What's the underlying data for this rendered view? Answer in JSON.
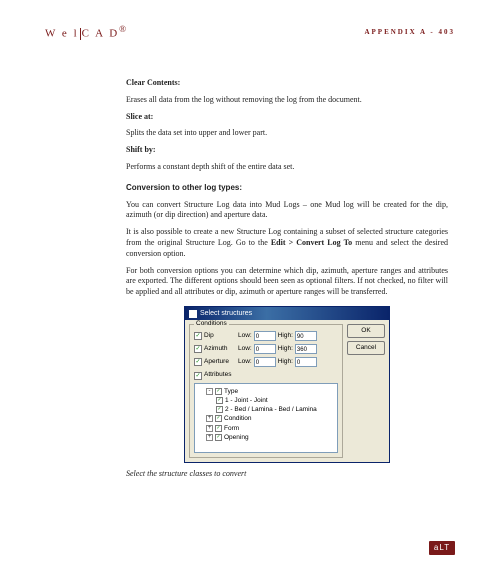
{
  "header": {
    "logo_left": "W e l",
    "logo_right": "C A D",
    "page_ref": "APPENDIX A - 403"
  },
  "body": {
    "h1": "Clear Contents:",
    "p1": "Erases all data from the log without removing the log from the document.",
    "h2": "Slice at:",
    "p2": "Splits the data set into upper and lower part.",
    "h3": "Shift by:",
    "p3": "Performs a constant depth shift of the entire data set.",
    "section": "Conversion to other log types:",
    "p4": "You can convert Structure Log data into Mud Logs – one Mud log will be created for the dip, azimuth (or dip direction) and aperture data.",
    "p5a": "It is also possible to create a new Structure Log containing a subset of selected structure categories from the original Structure Log. Go to the ",
    "p5b": "Edit > Convert Log To",
    "p5c": " menu and select the desired conversion option.",
    "p6": "For both conversion options you can determine which dip, azimuth, aperture ranges and attributes are exported. The different options should been seen as optional filters. If not checked, no filter will be applied and all attributes or dip, azimuth or aperture ranges will be transferred.",
    "caption": "Select the structure classes to convert"
  },
  "dialog": {
    "title": "Select structures",
    "conditions_label": "Conditions",
    "rows": [
      {
        "name": "Dip",
        "low": "0",
        "high": "90"
      },
      {
        "name": "Azimuth",
        "low": "0",
        "high": "360"
      },
      {
        "name": "Aperture",
        "low": "0",
        "high": "0"
      }
    ],
    "low_label": "Low:",
    "high_label": "High:",
    "attributes_label": "Attributes",
    "tree": {
      "root": "Type",
      "items": [
        "1 - Joint - Joint",
        "2 - Bed / Lamina - Bed / Lamina",
        "Condition",
        "Form",
        "Opening"
      ]
    },
    "ok": "OK",
    "cancel": "Cancel"
  },
  "footer": {
    "logo": "aLT"
  }
}
